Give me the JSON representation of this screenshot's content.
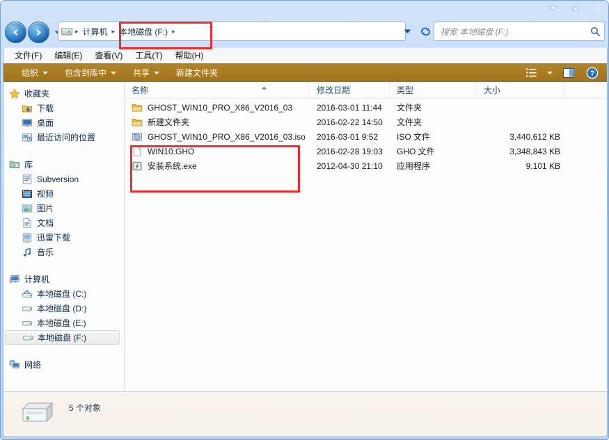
{
  "window": {
    "controls": [
      {
        "name": "minimize",
        "glyph": "minimize-icon"
      },
      {
        "name": "maximize",
        "glyph": "maximize-icon"
      },
      {
        "name": "close",
        "glyph": "close-icon"
      }
    ]
  },
  "address": {
    "back_label": "后退",
    "forward_label": "前进",
    "recent_label": "最近的页面",
    "breadcrumbs": [
      {
        "label": "计算机"
      },
      {
        "label": "本地磁盘 (F:)"
      }
    ],
    "dropdown_label": "以前的位置",
    "refresh_label": "刷新"
  },
  "search": {
    "placeholder": "搜索 本地磁盘 (F:)",
    "value": "",
    "icon": "search-icon"
  },
  "menubar": {
    "items": [
      {
        "label": "文件(F)"
      },
      {
        "label": "编辑(E)"
      },
      {
        "label": "查看(V)"
      },
      {
        "label": "工具(T)"
      },
      {
        "label": "帮助(H)"
      }
    ]
  },
  "toolbar": {
    "color": "#a97b23",
    "items": [
      {
        "label": "组织",
        "has_caret": true
      },
      {
        "label": "包含到库中",
        "has_caret": true
      },
      {
        "label": "共享",
        "has_caret": true
      },
      {
        "label": "新建文件夹",
        "has_caret": false
      }
    ],
    "right_buttons": [
      {
        "name": "view-options",
        "icon": "list-view-icon"
      },
      {
        "name": "view-dropdown",
        "icon": "chevron-down-icon"
      },
      {
        "name": "preview-pane",
        "icon": "preview-pane-icon"
      },
      {
        "name": "help",
        "icon": "help-icon"
      }
    ]
  },
  "navpane": {
    "groups": [
      {
        "header": {
          "label": "收藏夹",
          "icon": "star-icon"
        },
        "items": [
          {
            "label": "下载",
            "icon": "downloads-icon"
          },
          {
            "label": "桌面",
            "icon": "desktop-icon"
          },
          {
            "label": "最近访问的位置",
            "icon": "recent-places-icon"
          }
        ]
      },
      {
        "header": {
          "label": "库",
          "icon": "library-icon"
        },
        "items": [
          {
            "label": "Subversion",
            "icon": "subversion-icon"
          },
          {
            "label": "视频",
            "icon": "video-icon"
          },
          {
            "label": "图片",
            "icon": "pictures-icon"
          },
          {
            "label": "文档",
            "icon": "documents-icon"
          },
          {
            "label": "迅雷下载",
            "icon": "thunder-download-icon"
          },
          {
            "label": "音乐",
            "icon": "music-icon"
          }
        ]
      },
      {
        "header": {
          "label": "计算机",
          "icon": "computer-icon"
        },
        "items": [
          {
            "label": "本地磁盘 (C:)",
            "icon": "system-drive-icon",
            "selected": false
          },
          {
            "label": "本地磁盘 (D:)",
            "icon": "drive-icon",
            "selected": false
          },
          {
            "label": "本地磁盘 (E:)",
            "icon": "drive-icon",
            "selected": false
          },
          {
            "label": "本地磁盘 (F:)",
            "icon": "drive-icon",
            "selected": true
          }
        ]
      },
      {
        "header": {
          "label": "网络",
          "icon": "network-icon"
        },
        "items": []
      }
    ]
  },
  "filelist": {
    "columns": [
      {
        "label": "名称",
        "key": "name"
      },
      {
        "label": "修改日期",
        "key": "date"
      },
      {
        "label": "类型",
        "key": "type"
      },
      {
        "label": "大小",
        "key": "size"
      }
    ],
    "sort_column": "名称",
    "sort_direction": "ascending",
    "rows": [
      {
        "name": "GHOST_WIN10_PRO_X86_V2016_03",
        "date": "2016-03-01 11:44",
        "type": "文件夹",
        "size": "",
        "icon": "folder-icon"
      },
      {
        "name": "新建文件夹",
        "date": "2016-02-22 14:50",
        "type": "文件夹",
        "size": "",
        "icon": "folder-icon"
      },
      {
        "name": "GHOST_WIN10_PRO_X86_V2016_03.iso",
        "date": "2016-03-01 9:52",
        "type": "ISO 文件",
        "size": "3,440,612 KB",
        "icon": "iso-file-icon"
      },
      {
        "name": "WIN10.GHO",
        "date": "2016-02-28 19:03",
        "type": "GHO 文件",
        "size": "3,348,843 KB",
        "icon": "generic-file-icon"
      },
      {
        "name": "安装系统.exe",
        "date": "2012-04-30 21:10",
        "type": "应用程序",
        "size": "9,101 KB",
        "icon": "executable-icon"
      }
    ]
  },
  "statusbar": {
    "icon": "drive-large-icon",
    "text": "5 个对象"
  },
  "annotations": {
    "accent_color": "#ef2b2b",
    "boxes": [
      {
        "name": "address-breadcrumb-highlight"
      },
      {
        "name": "target-files-highlight"
      }
    ]
  }
}
